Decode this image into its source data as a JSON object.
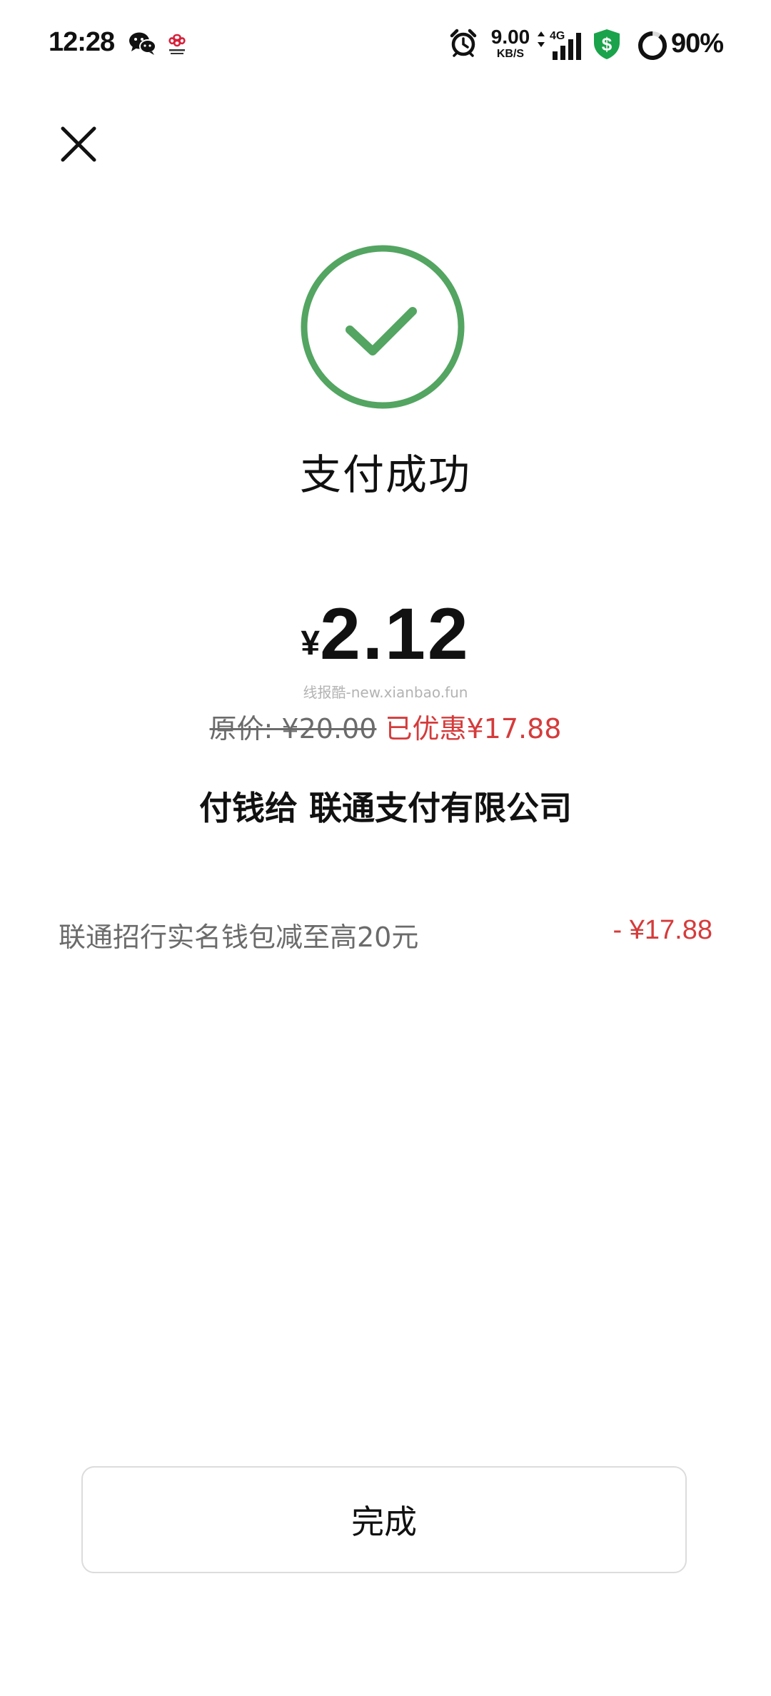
{
  "status_bar": {
    "time": "12:28",
    "net_speed_value": "9.00",
    "net_speed_unit": "KB/S",
    "network_type": "4G",
    "battery_percent": "90%",
    "icons": [
      "wechat-icon",
      "china-unicom-icon",
      "alarm-icon",
      "data-arrows-icon",
      "signal-icon",
      "shield-dollar-icon",
      "battery-ring-icon"
    ]
  },
  "colors": {
    "success_green": "#53a561",
    "discount_red": "#d53b3b",
    "muted_text": "#6b6b6b",
    "border": "#dcdcdc"
  },
  "close": {
    "icon": "close-icon"
  },
  "result": {
    "icon": "check-circle-icon",
    "title": "支付成功"
  },
  "amount": {
    "currency": "¥",
    "value": "2.12"
  },
  "watermark": "线报酷-new.xianbao.fun",
  "price": {
    "original": "原价: ¥20.00",
    "discount": "已优惠¥17.88"
  },
  "payee": "付钱给 联通支付有限公司",
  "discount_detail": {
    "name": "联通招行实名钱包减至高20元",
    "amount": "- ¥17.88"
  },
  "done_button": {
    "label": "完成"
  }
}
